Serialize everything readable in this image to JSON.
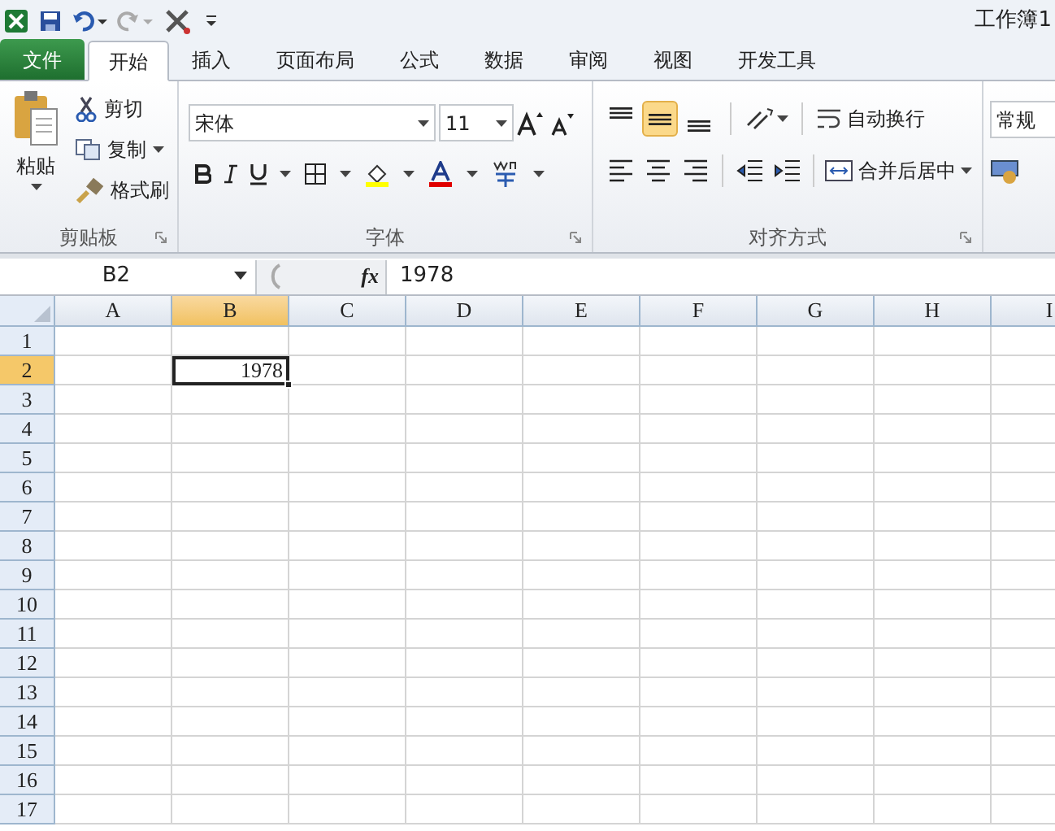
{
  "window": {
    "title": "工作簿1"
  },
  "tabs": [
    {
      "label": "文件",
      "kind": "file",
      "selected": false
    },
    {
      "label": "开始",
      "kind": "tab",
      "selected": true
    },
    {
      "label": "插入",
      "kind": "tab",
      "selected": false
    },
    {
      "label": "页面布局",
      "kind": "tab",
      "selected": false
    },
    {
      "label": "公式",
      "kind": "tab",
      "selected": false
    },
    {
      "label": "数据",
      "kind": "tab",
      "selected": false
    },
    {
      "label": "审阅",
      "kind": "tab",
      "selected": false
    },
    {
      "label": "视图",
      "kind": "tab",
      "selected": false
    },
    {
      "label": "开发工具",
      "kind": "tab",
      "selected": false
    }
  ],
  "clipboard": {
    "paste": "粘贴",
    "cut": "剪切",
    "copy": "复制",
    "format_painter": "格式刷",
    "label": "剪贴板"
  },
  "font": {
    "name": "宋体",
    "size": "11",
    "label": "字体"
  },
  "alignment": {
    "vertical_align": [
      {
        "pressed": false
      },
      {
        "pressed": true
      },
      {
        "pressed": false
      }
    ],
    "wrap_text": "自动换行",
    "merge_center": "合并后居中",
    "label": "对齐方式"
  },
  "number": {
    "format": "常规"
  },
  "formula_bar": {
    "name_box": "B2",
    "function_label": "fx",
    "value": "1978"
  },
  "grid": {
    "columns": [
      {
        "label": "A",
        "selected": false
      },
      {
        "label": "B",
        "selected": true
      },
      {
        "label": "C",
        "selected": false
      },
      {
        "label": "D",
        "selected": false
      },
      {
        "label": "E",
        "selected": false
      },
      {
        "label": "F",
        "selected": false
      },
      {
        "label": "G",
        "selected": false
      },
      {
        "label": "H",
        "selected": false
      },
      {
        "label": "I",
        "selected": false
      }
    ],
    "rows": [
      {
        "label": "1",
        "selected": false
      },
      {
        "label": "2",
        "selected": true
      },
      {
        "label": "3",
        "selected": false
      },
      {
        "label": "4",
        "selected": false
      },
      {
        "label": "5",
        "selected": false
      },
      {
        "label": "6",
        "selected": false
      },
      {
        "label": "7",
        "selected": false
      },
      {
        "label": "8",
        "selected": false
      },
      {
        "label": "9",
        "selected": false
      },
      {
        "label": "10",
        "selected": false
      },
      {
        "label": "11",
        "selected": false
      },
      {
        "label": "12",
        "selected": false
      },
      {
        "label": "13",
        "selected": false
      },
      {
        "label": "14",
        "selected": false
      },
      {
        "label": "15",
        "selected": false
      },
      {
        "label": "16",
        "selected": false
      },
      {
        "label": "17",
        "selected": false
      }
    ],
    "active_cell": {
      "value": "1978"
    }
  }
}
